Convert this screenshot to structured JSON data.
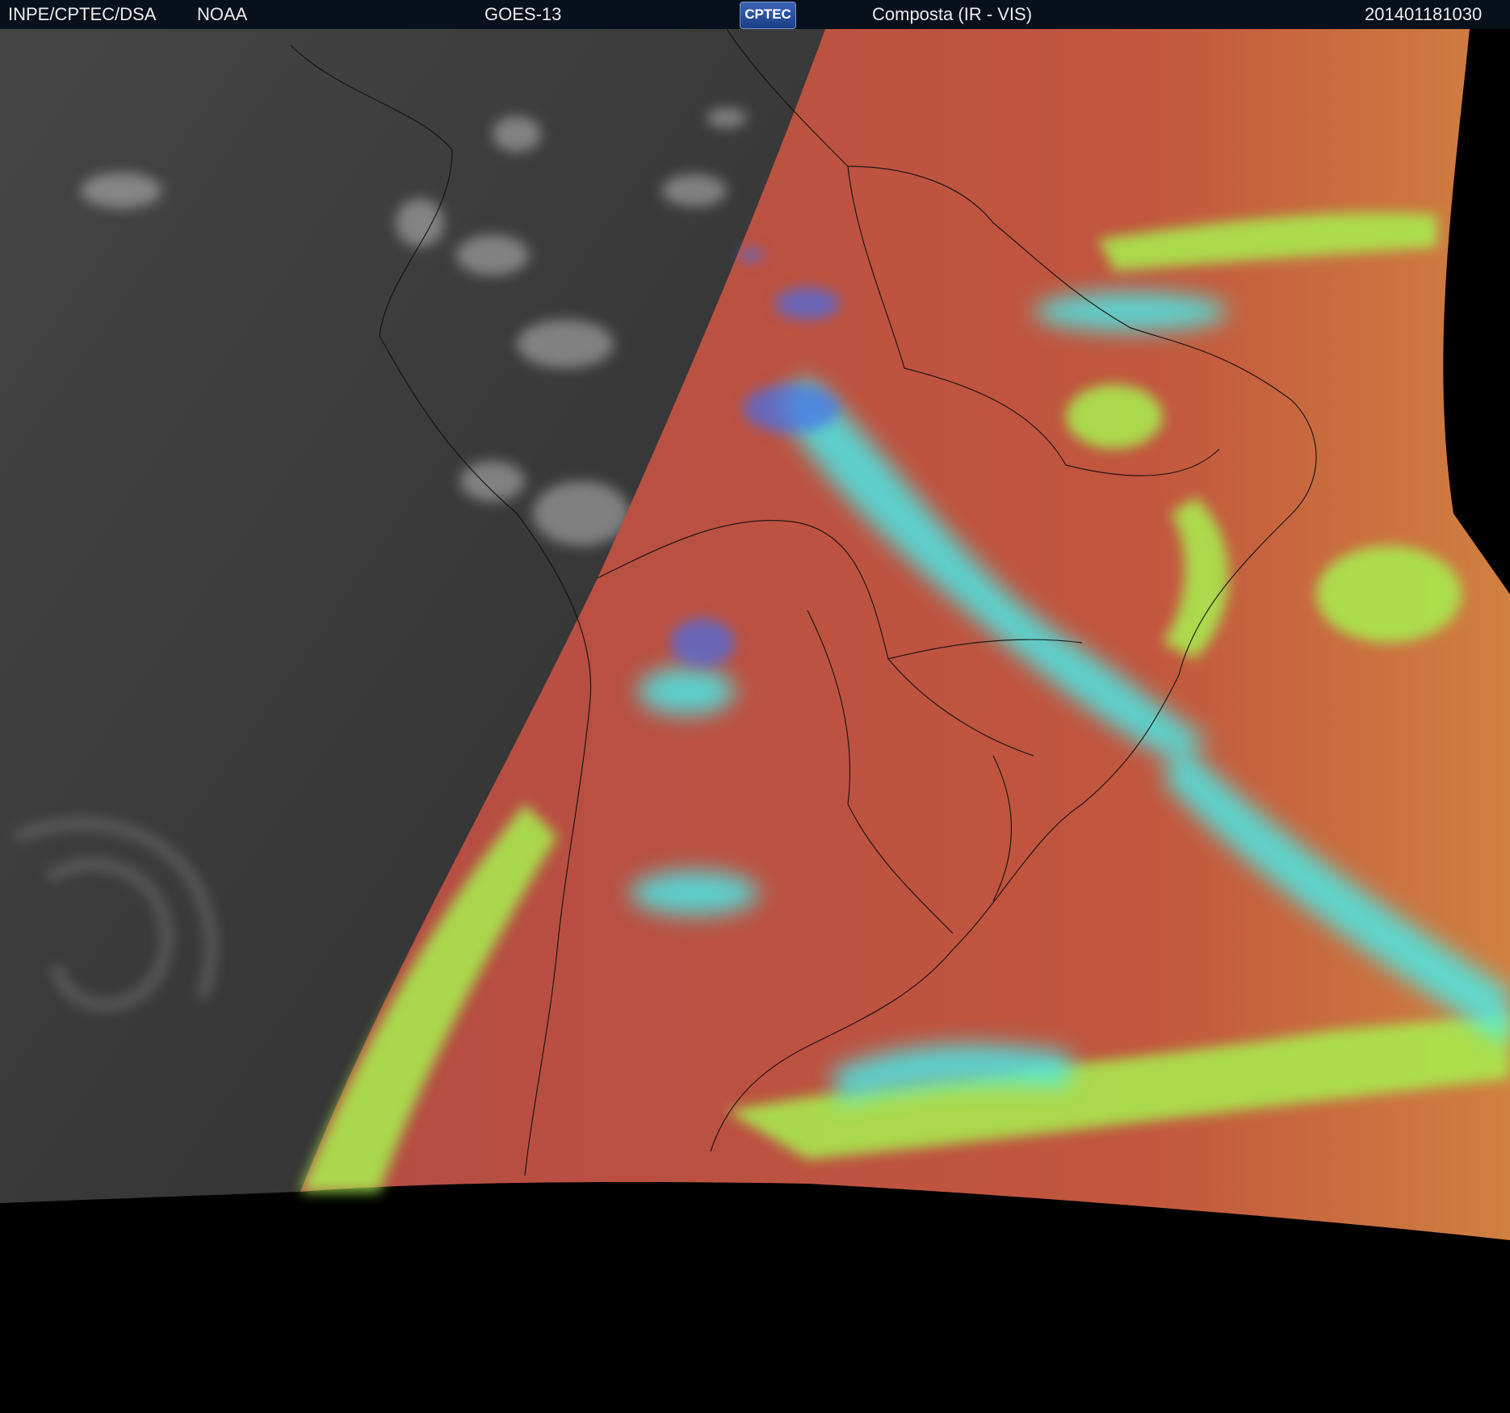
{
  "header": {
    "agency": "INPE/CPTEC/DSA",
    "source": "NOAA",
    "satellite": "GOES-13",
    "logo": "CPTEC",
    "product": "Composta (IR - VIS)",
    "timestamp": "201401181030"
  },
  "colors": {
    "header_bg": "#08101c",
    "night_ir": "#3c3c3c",
    "land_day": "#b04a42",
    "ocean_day": "#c8583c",
    "cloud_cyan": "#45f0f0",
    "cloud_lime": "#a8f050",
    "cloud_blue": "#4a6ee8",
    "outside_disk": "#000000"
  },
  "map": {
    "region": "South America",
    "night_side_channel": "IR",
    "day_side_channel": "IR - VIS composite",
    "borders": "country and state boundaries"
  }
}
